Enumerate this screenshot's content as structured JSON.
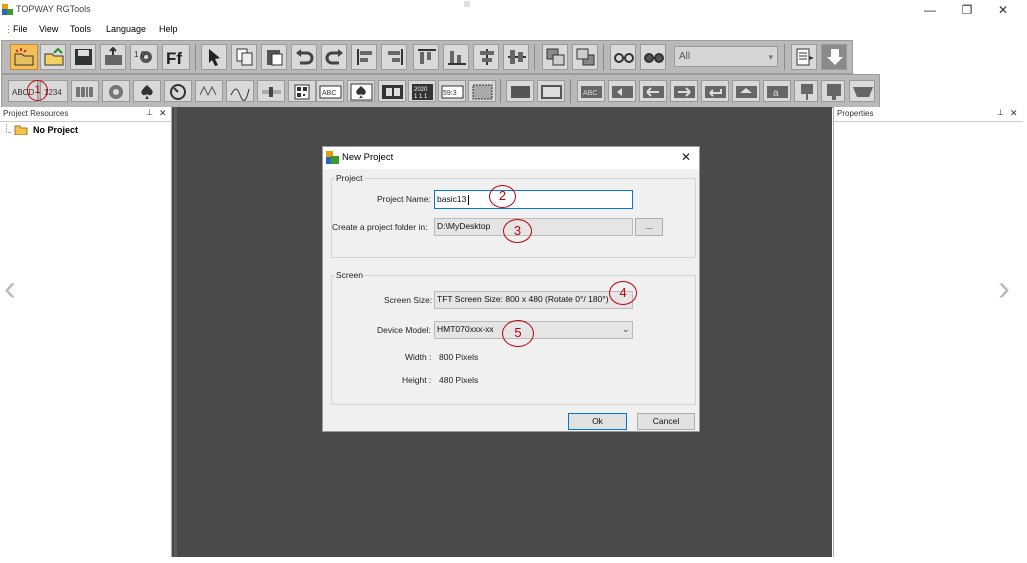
{
  "window": {
    "title": "TOPWAY RGTools",
    "minimize": "—",
    "restore": "❐",
    "close": "✕"
  },
  "menu": [
    "File",
    "View",
    "Tools",
    "Language",
    "Help"
  ],
  "toolbar": {
    "filter_value": "All"
  },
  "left_panel": {
    "title": "Project Resources",
    "tree_root": "No Project"
  },
  "right_panel": {
    "title": "Properties"
  },
  "dialog": {
    "title": "New Project",
    "project_group": "Project",
    "name_label": "Project Name:",
    "name_value": "basic13",
    "folder_label": "Create a project folder in:",
    "folder_value": "D:\\MyDesktop",
    "browse_label": "...",
    "screen_group": "Screen",
    "size_label": "Screen Size:",
    "size_value": "TFT Screen Size: 800 x 480 (Rotate 0°/ 180°)",
    "model_label": "Device Model:",
    "model_value": "HMT070xxx-xx",
    "width_label": "Width :",
    "width_value": "800 Pixels",
    "height_label": "Height :",
    "height_value": "480 Pixels",
    "ok_label": "Ok",
    "cancel_label": "Cancel"
  },
  "annotations": [
    "1",
    "2",
    "3",
    "4",
    "5"
  ],
  "nav": {
    "prev": "‹",
    "next": "›"
  }
}
